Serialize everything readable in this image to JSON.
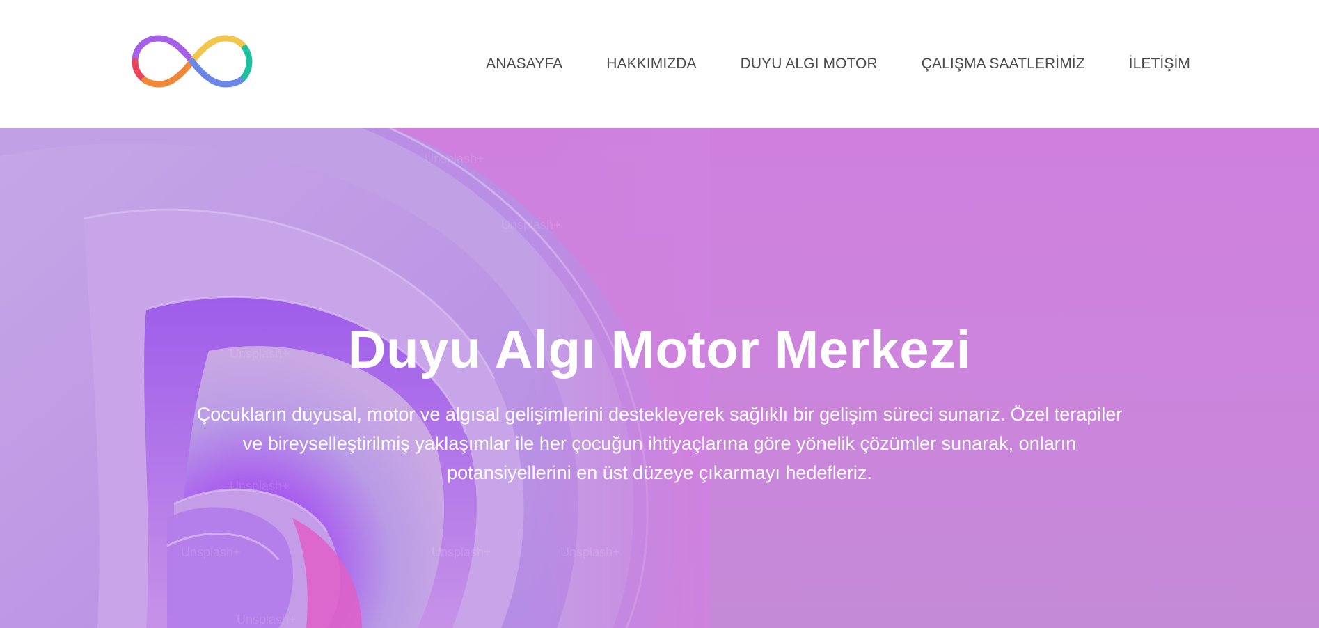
{
  "header": {
    "logo_icon": "infinity-logo-icon",
    "logo_colors": [
      "#e8455d",
      "#f0883a",
      "#f2c64a",
      "#8ab6ea",
      "#6b88e8",
      "#1fc0a0",
      "#a55fe8"
    ]
  },
  "nav": {
    "items": [
      {
        "label": "ANASAYFA"
      },
      {
        "label": "HAKKIMIZDA"
      },
      {
        "label": "DUYU ALGI MOTOR"
      },
      {
        "label": "ÇALIŞMA SAATLERİMİZ"
      },
      {
        "label": "İLETİŞİM"
      }
    ]
  },
  "hero": {
    "title": "Duyu Algı Motor Merkezi",
    "description": "Çocukların duyusal, motor ve algısal gelişimlerini destekleyerek sağlıklı bir gelişim süreci sunarız. Özel terapiler ve bireyselleştirilmiş yaklaşımlar ile her çocuğun ihtiyaçlarına göre yönelik çözümler sunarak, onların potansiyellerini en üst düzeye çıkarmayı hedefleriz.",
    "background_color": "#cd82dd",
    "watermark_text": "Unsplash+"
  }
}
